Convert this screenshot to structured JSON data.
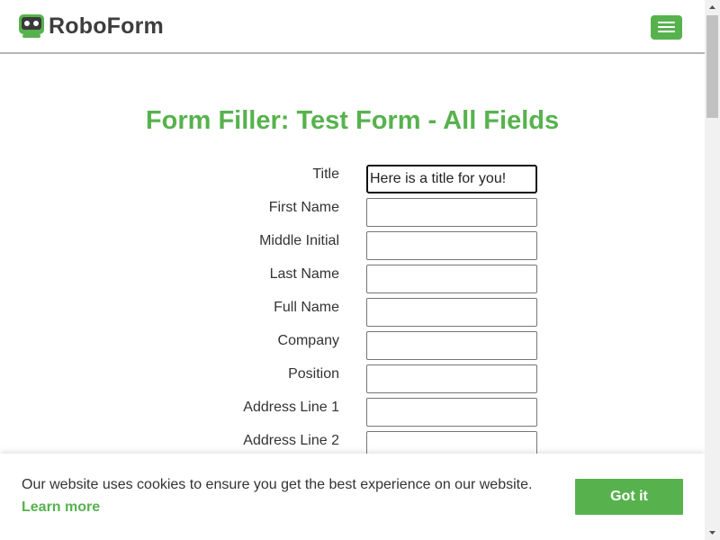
{
  "header": {
    "brand": "RoboForm",
    "menu_icon": "hamburger-menu-icon",
    "accent_color": "#57b24e"
  },
  "page_title": "Form Filler: Test Form - All Fields",
  "form": {
    "fields": [
      {
        "label": "Title",
        "value": "Here is a title for you!",
        "focused": true
      },
      {
        "label": "First Name",
        "value": ""
      },
      {
        "label": "Middle Initial",
        "value": ""
      },
      {
        "label": "Last Name",
        "value": ""
      },
      {
        "label": "Full Name",
        "value": ""
      },
      {
        "label": "Company",
        "value": ""
      },
      {
        "label": "Position",
        "value": ""
      },
      {
        "label": "Address Line 1",
        "value": ""
      },
      {
        "label": "Address Line 2",
        "value": ""
      }
    ]
  },
  "cookie_banner": {
    "message": "Our website uses cookies to ensure you get the best experience on our website.",
    "learn_more": "Learn more",
    "accept_label": "Got it"
  },
  "scrollbar": {
    "up_icon": "scroll-up-arrow-icon",
    "down_icon": "scroll-down-arrow-icon"
  }
}
